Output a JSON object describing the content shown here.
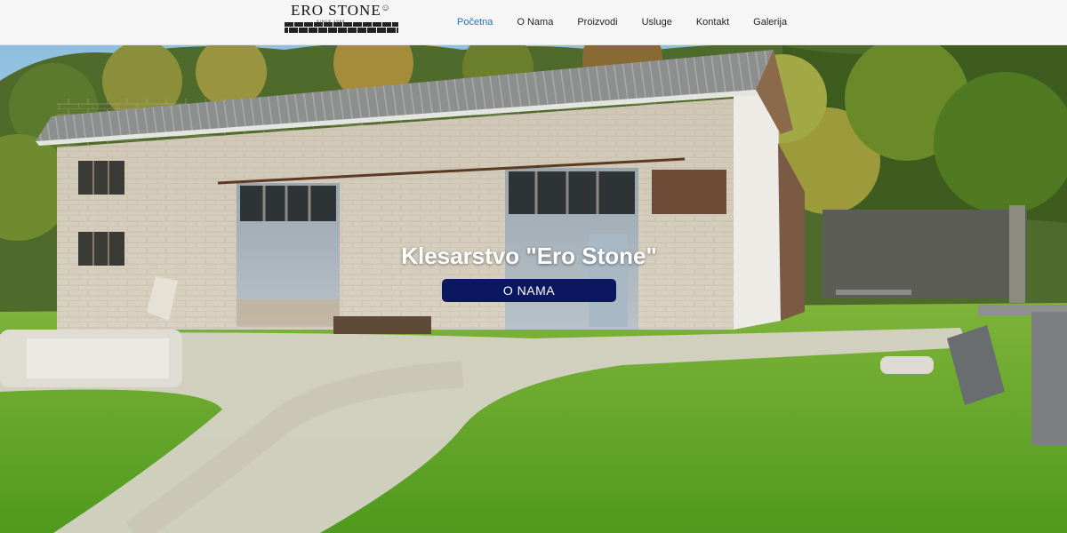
{
  "header": {
    "logo_text": "ERO STONE",
    "logo_subtext": "SINCE 1985"
  },
  "nav": {
    "items": [
      {
        "label": "Početna",
        "active": true
      },
      {
        "label": "O Nama",
        "active": false
      },
      {
        "label": "Proizvodi",
        "active": false
      },
      {
        "label": "Usluge",
        "active": false
      },
      {
        "label": "Kontakt",
        "active": false
      },
      {
        "label": "Galerija",
        "active": false
      }
    ]
  },
  "hero": {
    "title": "Klesarstvo \"Ero Stone\"",
    "button_label": "O NAMA"
  },
  "colors": {
    "nav_active": "#1e73be",
    "button_bg": "#0c1762",
    "header_bg": "#f6f6f6"
  }
}
